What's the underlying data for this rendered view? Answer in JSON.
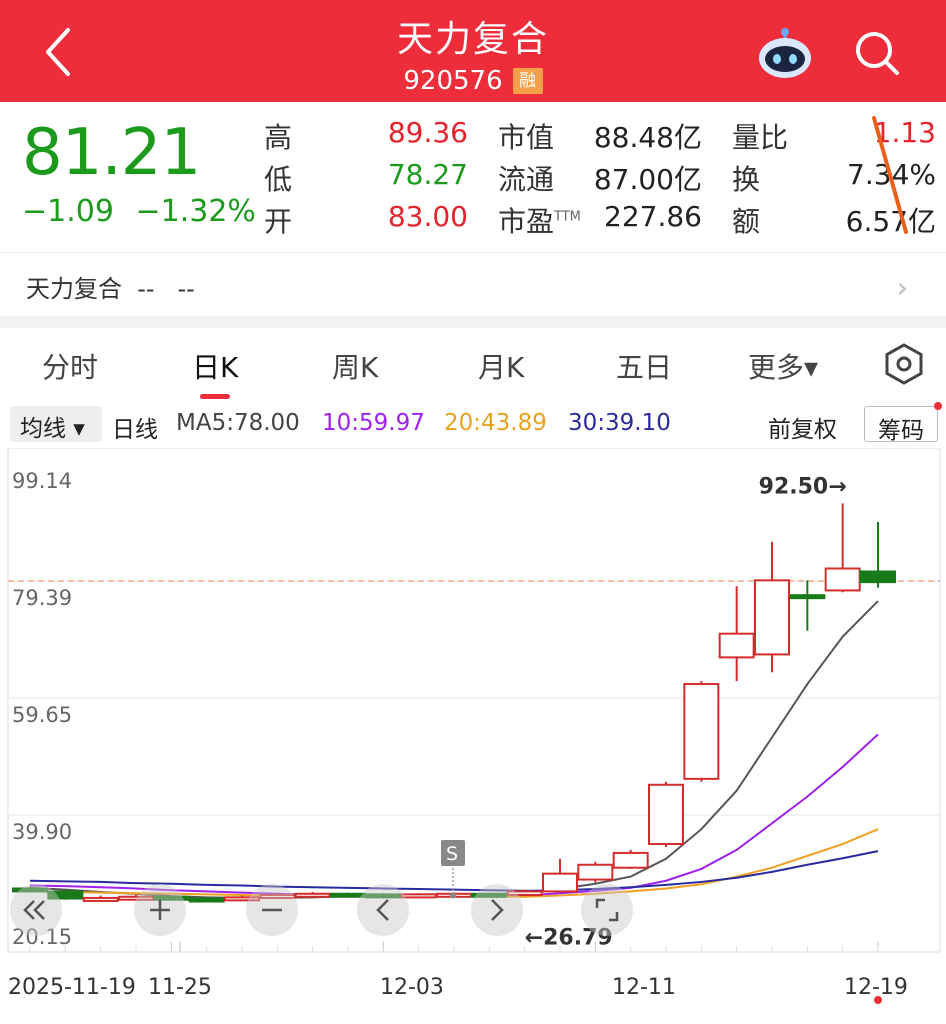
{
  "header": {
    "title": "天力复合",
    "code": "920576",
    "badge": "融"
  },
  "quote": {
    "price": "81.21",
    "change": "−1.09",
    "change_pct": "−1.32%",
    "cells": [
      {
        "label": "高",
        "value": "89.36",
        "color": "red"
      },
      {
        "label": "低",
        "value": "78.27",
        "color": "green"
      },
      {
        "label": "开",
        "value": "83.00",
        "color": "red"
      },
      {
        "label": "市值",
        "value": "88.48亿",
        "color": "black"
      },
      {
        "label": "流通",
        "value": "87.00亿",
        "color": "black"
      },
      {
        "label": "市盈",
        "value": "227.86",
        "color": "black",
        "sup": "TTM"
      },
      {
        "label": "量比",
        "value": "1.13",
        "color": "red"
      },
      {
        "label": "换",
        "value": "7.34%",
        "color": "black"
      },
      {
        "label": "额",
        "value": "6.57亿",
        "color": "black"
      }
    ]
  },
  "namebar": {
    "name": "天力复合",
    "v1": "--",
    "v2": "--"
  },
  "tabs": [
    {
      "label": "分时",
      "active": false
    },
    {
      "label": "日K",
      "active": true
    },
    {
      "label": "周K",
      "active": false
    },
    {
      "label": "月K",
      "active": false
    },
    {
      "label": "五日",
      "active": false
    },
    {
      "label": "更多▾",
      "active": false
    }
  ],
  "ma_row": {
    "avg_label": "均线 ▾",
    "period": "日线",
    "ma5": "MA5:78.00",
    "ma10": "10:59.97",
    "ma20": "20:43.89",
    "ma30": "30:39.10",
    "fuquan": "前复权",
    "chouma": "筹码",
    "colors": {
      "ma5": "#444444",
      "ma10": "#a020f0",
      "ma20": "#f0a020",
      "ma30": "#2020a0"
    }
  },
  "chart_data": {
    "type": "candlestick",
    "y_ticks": [
      "99.14",
      "79.39",
      "59.65",
      "39.90",
      "20.15"
    ],
    "ylim": [
      20.15,
      99.14
    ],
    "x_ticks": [
      "2025-11-19",
      "11-25",
      "12-03",
      "12-11",
      "12-19"
    ],
    "last_price_line": 79.39,
    "annotations": {
      "high": "92.50→",
      "low": "←26.79",
      "marker": "S"
    },
    "candles": [
      {
        "o": 27.5,
        "c": 27.0,
        "h": 27.8,
        "l": 26.8
      },
      {
        "o": 27.0,
        "c": 25.8,
        "h": 27.2,
        "l": 25.6
      },
      {
        "o": 25.8,
        "c": 25.9,
        "h": 26.3,
        "l": 25.5
      },
      {
        "o": 25.9,
        "c": 26.1,
        "h": 26.4,
        "l": 25.7
      },
      {
        "o": 26.1,
        "c": 25.8,
        "h": 26.2,
        "l": 25.6
      },
      {
        "o": 25.8,
        "c": 25.6,
        "h": 26.0,
        "l": 25.4
      },
      {
        "o": 25.6,
        "c": 26.0,
        "h": 26.3,
        "l": 25.5
      },
      {
        "o": 26.0,
        "c": 26.4,
        "h": 26.8,
        "l": 25.9
      },
      {
        "o": 26.4,
        "c": 26.6,
        "h": 26.9,
        "l": 26.2
      },
      {
        "o": 26.6,
        "c": 26.5,
        "h": 26.8,
        "l": 26.3
      },
      {
        "o": 26.5,
        "c": 26.4,
        "h": 26.7,
        "l": 26.2
      },
      {
        "o": 26.4,
        "c": 26.5,
        "h": 26.7,
        "l": 26.2
      },
      {
        "o": 26.5,
        "c": 26.6,
        "h": 26.8,
        "l": 26.3
      },
      {
        "o": 26.6,
        "c": 26.4,
        "h": 26.8,
        "l": 26.2
      },
      {
        "o": 26.4,
        "c": 27.0,
        "h": 27.3,
        "l": 26.79
      },
      {
        "o": 27.0,
        "c": 30.0,
        "h": 32.5,
        "l": 26.9
      },
      {
        "o": 29.0,
        "c": 31.5,
        "h": 32.0,
        "l": 28.5
      },
      {
        "o": 31.0,
        "c": 33.5,
        "h": 34.0,
        "l": 30.8
      },
      {
        "o": 35.0,
        "c": 45.0,
        "h": 45.5,
        "l": 34.5
      },
      {
        "o": 46.0,
        "c": 62.0,
        "h": 62.5,
        "l": 45.5
      },
      {
        "o": 66.5,
        "c": 70.5,
        "h": 78.5,
        "l": 62.5
      },
      {
        "o": 67.0,
        "c": 79.5,
        "h": 86.0,
        "l": 64.0
      },
      {
        "o": 77.0,
        "c": 76.8,
        "h": 79.5,
        "l": 71.0
      },
      {
        "o": 77.8,
        "c": 81.5,
        "h": 92.5,
        "l": 77.5
      },
      {
        "o": 81.0,
        "c": 79.2,
        "h": 89.36,
        "l": 78.27
      }
    ],
    "ma": {
      "ma5": [
        27.6,
        27.3,
        26.9,
        26.6,
        26.2,
        26.0,
        25.9,
        25.9,
        26.0,
        26.2,
        26.4,
        26.5,
        26.5,
        26.5,
        26.6,
        27.4,
        28.3,
        29.5,
        32.5,
        37.5,
        44.0,
        53.0,
        62.0,
        70.0,
        76.0
      ],
      "ma10": [
        28.0,
        27.9,
        27.7,
        27.5,
        27.2,
        27.0,
        26.8,
        26.6,
        26.4,
        26.3,
        26.2,
        26.2,
        26.2,
        26.2,
        26.3,
        26.7,
        27.1,
        27.6,
        28.8,
        30.8,
        34.0,
        38.5,
        43.0,
        48.0,
        53.5
      ],
      "ma20": [
        27.0,
        26.9,
        26.8,
        26.7,
        26.6,
        26.5,
        26.4,
        26.3,
        26.3,
        26.2,
        26.2,
        26.2,
        26.2,
        26.1,
        26.1,
        26.3,
        26.6,
        27.0,
        27.5,
        28.2,
        29.5,
        31.0,
        33.0,
        35.0,
        37.5
      ],
      "ma30": [
        28.8,
        28.7,
        28.6,
        28.4,
        28.3,
        28.1,
        28.0,
        27.8,
        27.7,
        27.6,
        27.5,
        27.4,
        27.3,
        27.2,
        27.1,
        27.2,
        27.4,
        27.7,
        28.1,
        28.6,
        29.3,
        30.3,
        31.5,
        32.6,
        33.8
      ]
    }
  }
}
